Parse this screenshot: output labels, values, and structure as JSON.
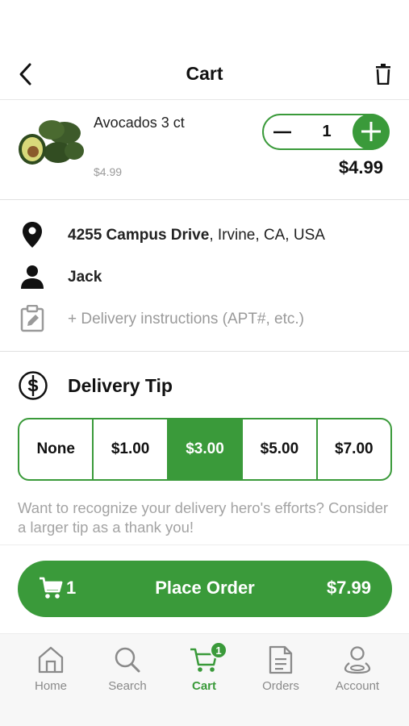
{
  "header": {
    "title": "Cart"
  },
  "item": {
    "name": "Avocados 3 ct",
    "unit_price": "$4.99",
    "quantity": "1",
    "total": "$4.99"
  },
  "details": {
    "address_bold": "4255 Campus Drive",
    "address_rest": ", Irvine, CA, USA",
    "name": "Jack",
    "instructions_placeholder": "+ Delivery instructions (APT#, etc.)"
  },
  "tip": {
    "title": "Delivery Tip",
    "options": [
      "None",
      "$1.00",
      "$3.00",
      "$5.00",
      "$7.00"
    ],
    "selected": "$3.00",
    "note": "Want to recognize your delivery hero's efforts? Consider a larger tip as a thank you!"
  },
  "order": {
    "cart_count": "1",
    "label": "Place Order",
    "total": "$7.99"
  },
  "tabs": [
    {
      "label": "Home",
      "icon": "home-icon"
    },
    {
      "label": "Search",
      "icon": "search-icon"
    },
    {
      "label": "Cart",
      "icon": "cart-icon",
      "badge": "1"
    },
    {
      "label": "Orders",
      "icon": "orders-icon"
    },
    {
      "label": "Account",
      "icon": "account-icon"
    }
  ],
  "colors": {
    "accent": "#3a9a3a",
    "muted": "#9a9a9a"
  }
}
